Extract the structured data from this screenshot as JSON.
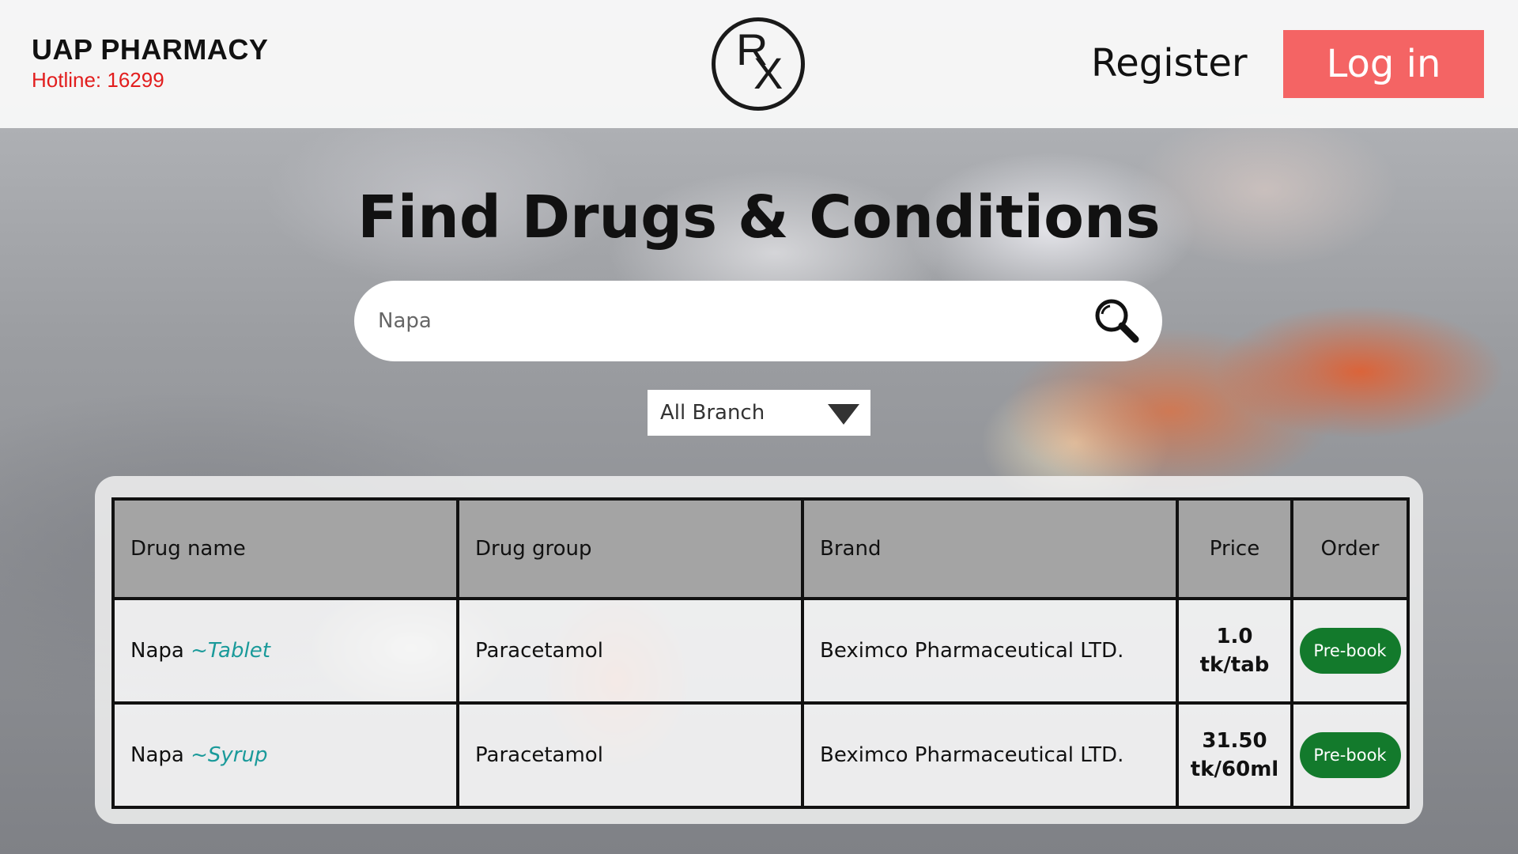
{
  "header": {
    "brand": "UAP PHARMACY",
    "hotline": "Hotline: 16299",
    "logo": {
      "letter_r": "R",
      "letter_x": "X"
    },
    "register_label": "Register",
    "login_label": "Log in"
  },
  "main": {
    "title": "Find Drugs & Conditions",
    "search": {
      "value": "Napa",
      "placeholder": "Napa"
    },
    "branch_select": {
      "selected": "All Branch"
    }
  },
  "table": {
    "headers": {
      "drug_name": "Drug name",
      "drug_group": "Drug group",
      "brand": "Brand",
      "price": "Price",
      "order": "Order"
    },
    "rows": [
      {
        "name": "Napa",
        "form": "~Tablet",
        "group": "Paracetamol",
        "brand": "Beximco Pharmaceutical LTD.",
        "price_amount": "1.0",
        "price_unit": "tk/tab",
        "order_label": "Pre-book"
      },
      {
        "name": "Napa",
        "form": "~Syrup",
        "group": "Paracetamol",
        "brand": "Beximco Pharmaceutical LTD.",
        "price_amount": "31.50",
        "price_unit": "tk/60ml",
        "order_label": "Pre-book"
      }
    ]
  },
  "colors": {
    "login_button": "#f46464",
    "hotline_text": "#e21d1d",
    "prebook_button": "#137a2c",
    "form_text": "#1a9a9a"
  }
}
